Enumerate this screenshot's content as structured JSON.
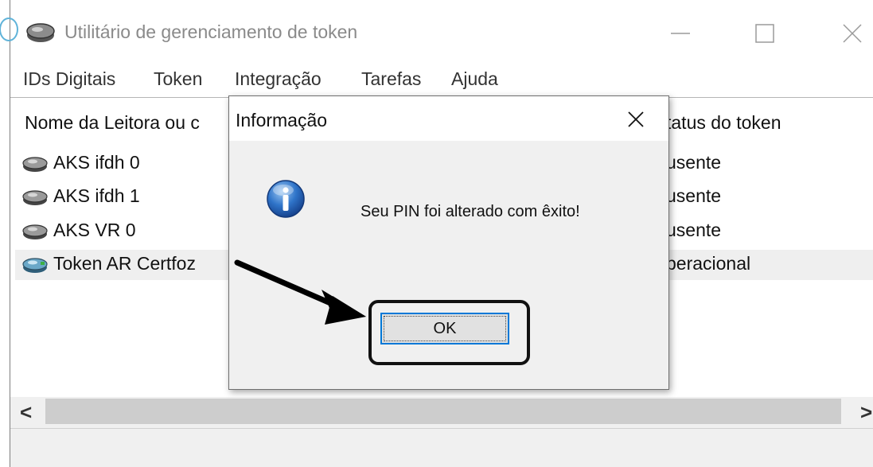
{
  "window": {
    "title": "Utilitário de gerenciamento de token",
    "controls": {
      "minimize_icon": "minimize-icon",
      "maximize_icon": "maximize-icon",
      "close_icon": "close-icon"
    }
  },
  "menu": {
    "items": [
      {
        "label": "IDs Digitais"
      },
      {
        "label": "Token"
      },
      {
        "label": "Integração"
      },
      {
        "label": "Tarefas"
      },
      {
        "label": "Ajuda"
      }
    ]
  },
  "list": {
    "columns": {
      "name": "Nome da Leitora ou c",
      "status": "tatus do token"
    },
    "rows": [
      {
        "name": "AKS ifdh 0",
        "status": "usente",
        "icon": "card-reader-icon"
      },
      {
        "name": "AKS ifdh 1",
        "status": "usente",
        "icon": "card-reader-icon"
      },
      {
        "name": "AKS VR 0",
        "status": "usente",
        "icon": "card-reader-icon"
      },
      {
        "name": "Token AR Certfoz",
        "status": "peracional",
        "icon": "token-reader-icon"
      }
    ]
  },
  "scrollbar": {
    "left_arrow": "<",
    "right_arrow": ">"
  },
  "dialog": {
    "title": "Informação",
    "message": "Seu PIN foi alterado com êxito!",
    "ok_label": "OK",
    "icon": "info-icon"
  },
  "colors": {
    "accent": "#0078d7",
    "info_icon_blue": "#1d5fb0",
    "dialog_bg": "#f0f0f0"
  }
}
